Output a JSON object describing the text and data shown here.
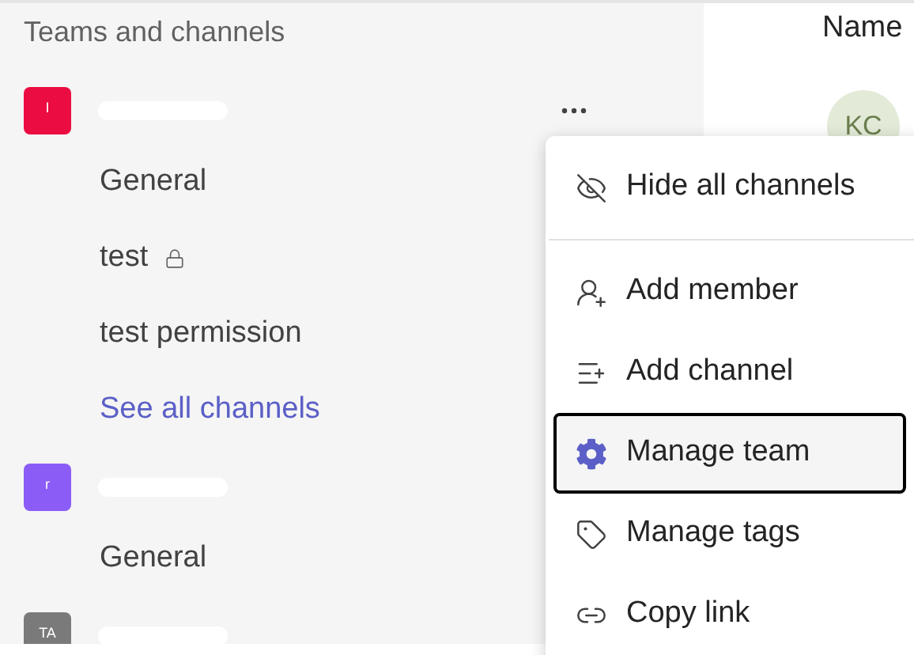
{
  "sidebar": {
    "title": "Teams and channels",
    "teams": [
      {
        "avatar": "I",
        "color": "#eb0c41",
        "more_options": true,
        "channels": [
          {
            "kind": "channel",
            "label": "General",
            "locked": false
          },
          {
            "kind": "channel",
            "label": "test",
            "locked": true
          },
          {
            "kind": "channel",
            "label": "test permission",
            "locked": false
          },
          {
            "kind": "link",
            "label": "See all channels",
            "locked": false
          }
        ]
      },
      {
        "avatar": "r",
        "color": "#8b5cf6",
        "more_options": false,
        "channels": [
          {
            "kind": "channel",
            "label": "General",
            "locked": false
          }
        ]
      },
      {
        "avatar": "TA",
        "color": "#7a7a7a",
        "more_options": false
      }
    ]
  },
  "members": {
    "column_header": "Name",
    "avatar": "KC"
  },
  "menu": {
    "items": [
      {
        "kind": "item",
        "label": "Hide all channels",
        "selected": false
      },
      {
        "kind": "divider"
      },
      {
        "kind": "item",
        "label": "Add member",
        "selected": false
      },
      {
        "kind": "item",
        "label": "Add channel",
        "selected": false
      },
      {
        "kind": "item",
        "label": "Manage team",
        "selected": true
      },
      {
        "kind": "item",
        "label": "Manage tags",
        "selected": false
      },
      {
        "kind": "item",
        "label": "Copy link",
        "selected": false
      }
    ]
  }
}
